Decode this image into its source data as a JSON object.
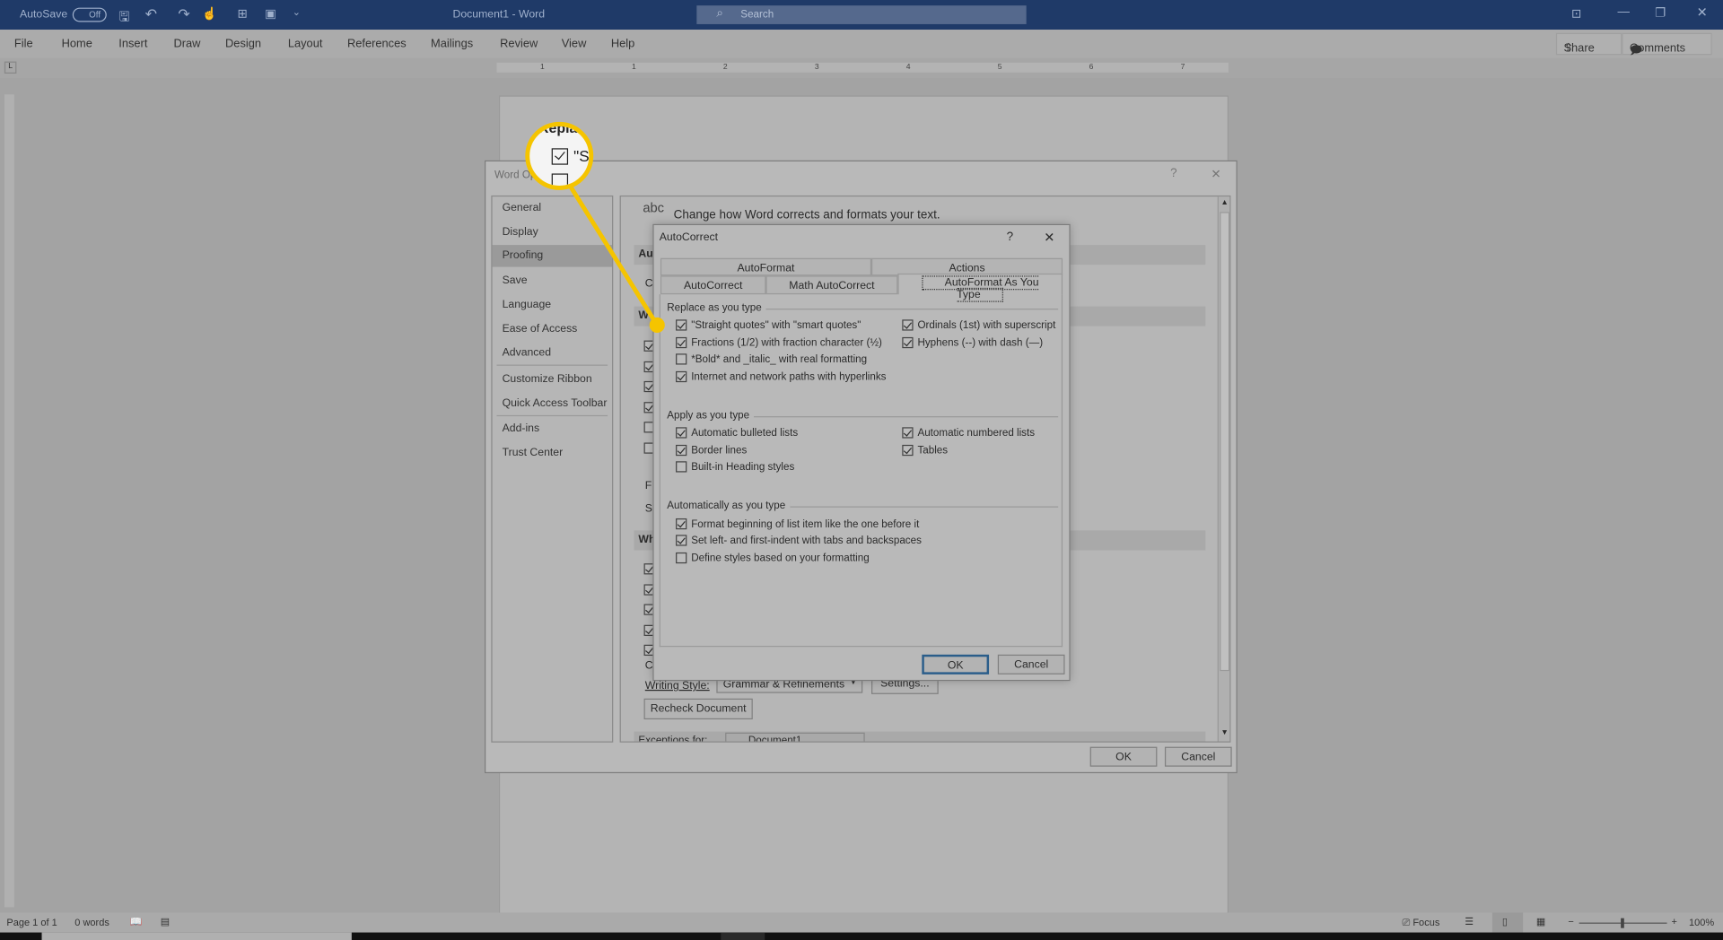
{
  "titlebar": {
    "autosave": "AutoSave",
    "autosave_state": "Off",
    "title": "Document1 - Word",
    "search_placeholder": "Search"
  },
  "menu": [
    "File",
    "Home",
    "Insert",
    "Draw",
    "Design",
    "Layout",
    "References",
    "Mailings",
    "Review",
    "View",
    "Help"
  ],
  "share": "Share",
  "comments": "Comments",
  "ruler": [
    "1",
    "1",
    "2",
    "3",
    "4",
    "5",
    "6",
    "7"
  ],
  "options": {
    "title": "Word Options",
    "help": "?",
    "close": "✕",
    "nav": [
      "General",
      "Display",
      "Proofing",
      "Save",
      "Language",
      "Ease of Access",
      "Advanced",
      "Customize Ribbon",
      "Quick Access Toolbar",
      "Add-ins",
      "Trust Center"
    ],
    "selected": "Proofing",
    "header_icon": "abc",
    "header": "Change how Word corrects and formats your text.",
    "sections": [
      "Au",
      "W",
      "Wh"
    ],
    "partial": [
      "C",
      "F",
      "Sp",
      "C"
    ],
    "writing_style_label": "Writing Style:",
    "writing_style_value": "Grammar & Refinements",
    "settings": "Settings...",
    "recheck": "Recheck Document",
    "exceptions_label": "Exceptions for:",
    "exceptions_value": "Document1",
    "ok": "OK",
    "cancel": "Cancel"
  },
  "autocorrect": {
    "title": "AutoCorrect",
    "help": "?",
    "close": "✕",
    "tabs_back": [
      "AutoFormat",
      "Actions"
    ],
    "tabs_front": [
      "AutoCorrect",
      "Math AutoCorrect",
      "AutoFormat As You Type"
    ],
    "active_tab": "AutoFormat As You Type",
    "groups": [
      {
        "title": "Replace as you type",
        "items": [
          {
            "label": "\"Straight quotes\" with \"smart quotes\"",
            "checked": true
          },
          {
            "label": "Ordinals (1st) with superscript",
            "checked": true
          },
          {
            "label": "Fractions (1/2) with fraction character (½)",
            "checked": true
          },
          {
            "label": "Hyphens (--) with dash (—)",
            "checked": true
          },
          {
            "label": "*Bold* and _italic_ with real formatting",
            "checked": false
          },
          {
            "label": "Internet and network paths with hyperlinks",
            "checked": true
          }
        ]
      },
      {
        "title": "Apply as you type",
        "items": [
          {
            "label": "Automatic bulleted lists",
            "checked": true
          },
          {
            "label": "Automatic numbered lists",
            "checked": true
          },
          {
            "label": "Border lines",
            "checked": true
          },
          {
            "label": "Tables",
            "checked": true
          },
          {
            "label": "Built-in Heading styles",
            "checked": false
          }
        ]
      },
      {
        "title": "Automatically as you type",
        "items": [
          {
            "label": "Format beginning of list item like the one before it",
            "checked": true
          },
          {
            "label": "Set left- and first-indent with tabs and backspaces",
            "checked": true
          },
          {
            "label": "Define styles based on your formatting",
            "checked": false
          }
        ]
      }
    ],
    "ok": "OK",
    "cancel": "Cancel"
  },
  "callout": {
    "text": "Repla",
    "item": "\"S",
    "color": "#f5c400"
  },
  "status": {
    "page": "Page 1 of 1",
    "words": "0 words",
    "focus": "Focus",
    "zoom": "100%"
  }
}
